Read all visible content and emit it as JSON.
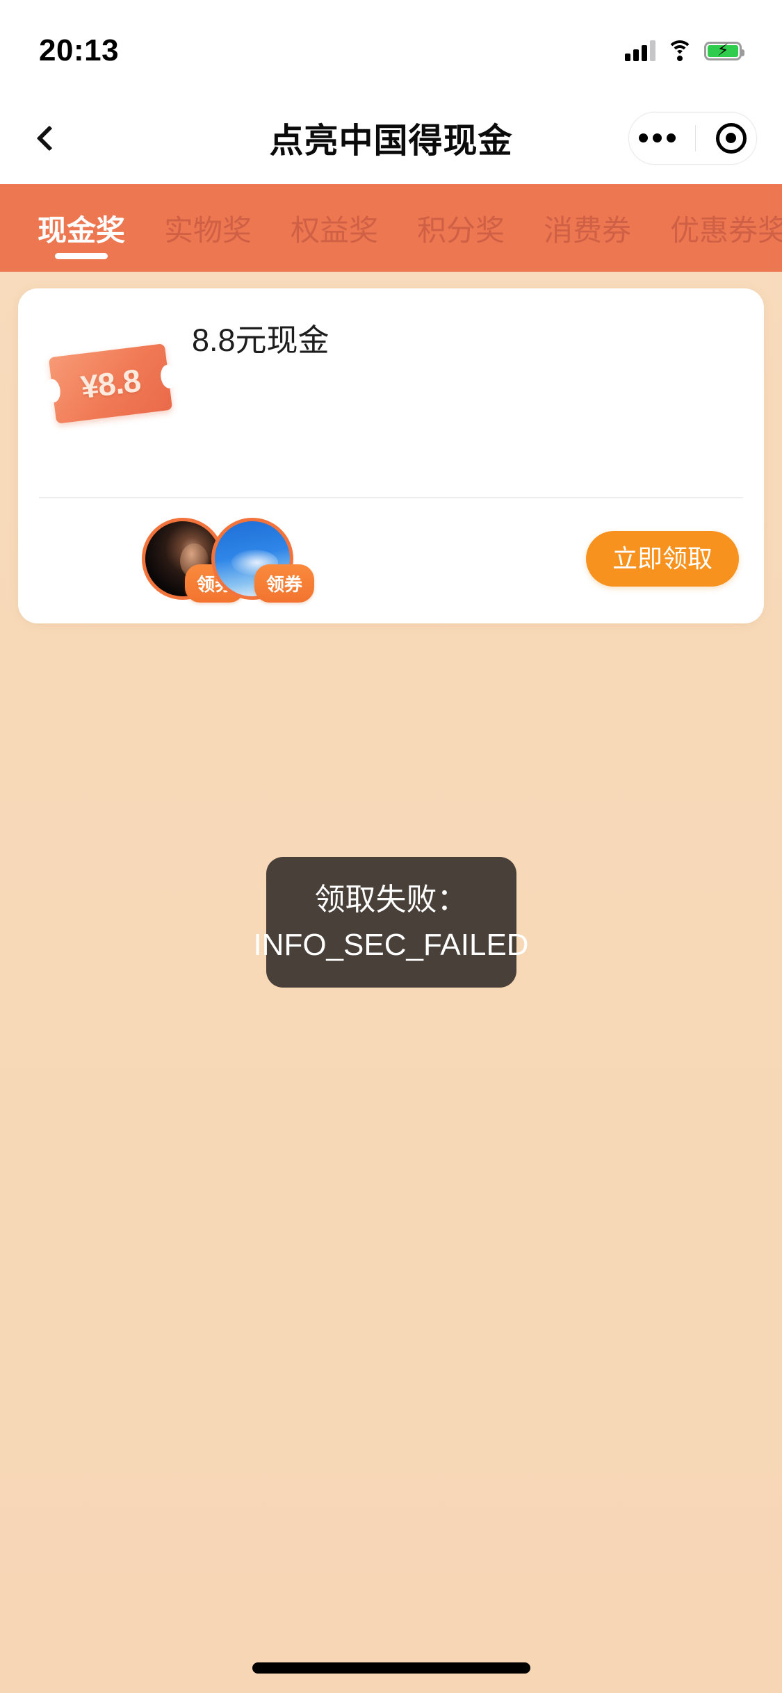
{
  "status_bar": {
    "time": "20:13",
    "signal_icon": "signal-bars-icon",
    "wifi_icon": "wifi-icon",
    "battery_icon": "battery-charging-icon"
  },
  "nav": {
    "back_icon": "back-chevron-icon",
    "title": "点亮中国得现金",
    "more_icon": "more-dots-icon",
    "close_icon": "target-circle-icon"
  },
  "tabs": {
    "active_index": 0,
    "items": [
      {
        "label": "现金奖"
      },
      {
        "label": "实物奖"
      },
      {
        "label": "权益奖"
      },
      {
        "label": "积分奖"
      },
      {
        "label": "消费券"
      },
      {
        "label": "优惠券奖"
      }
    ]
  },
  "prize_card": {
    "thumb_icon": "coupon-ticket-icon",
    "thumb_amount": "¥8.8",
    "title": "8.8元现金",
    "avatars": [
      {
        "name": "avatar-person",
        "badge": "领券"
      },
      {
        "name": "avatar-sky",
        "badge": "领券"
      }
    ],
    "claim_button": "立即领取"
  },
  "toast": {
    "line1": "领取失败：",
    "line2": "INFO_SEC_FAILED"
  },
  "colors": {
    "page_background": "#f7d9b8",
    "tab_bar": "#ec7751",
    "tab_inactive_text": "#cf6045",
    "accent_orange": "#f7921e",
    "badge_orange": "#f2742f",
    "toast_background": "#4a403a",
    "battery_green": "#2fcc4e"
  }
}
